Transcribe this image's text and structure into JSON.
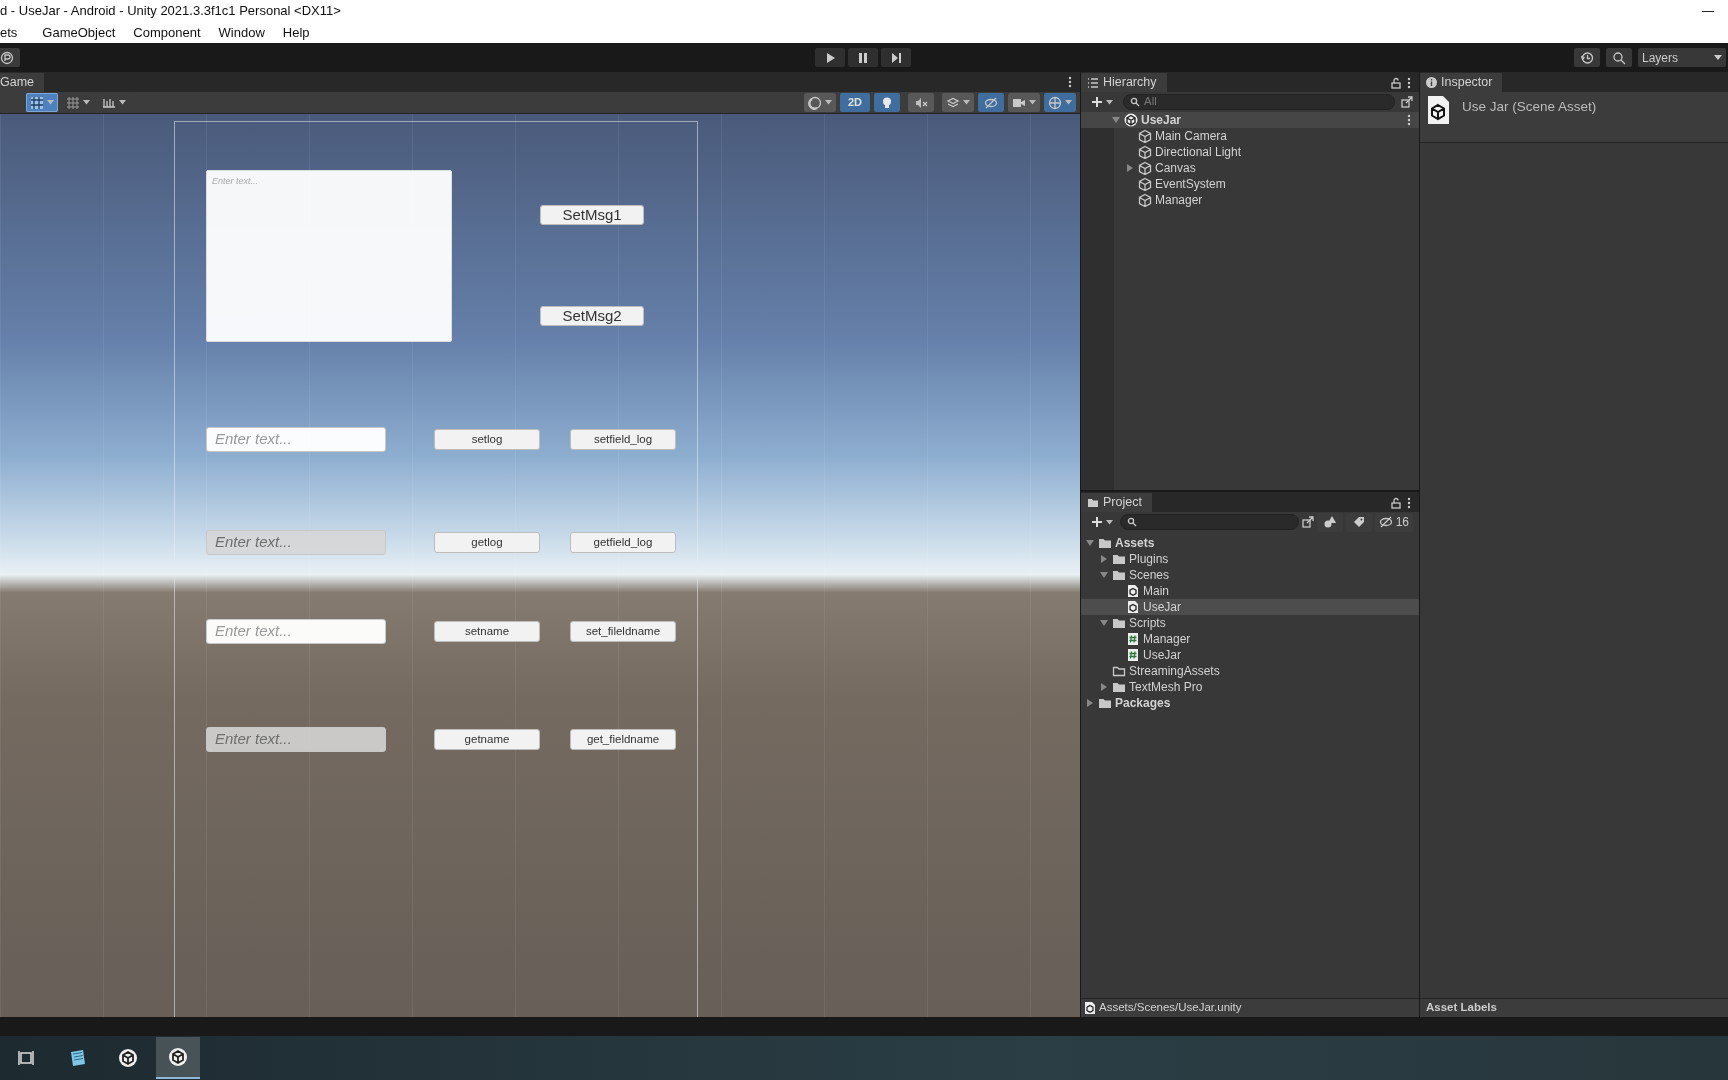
{
  "window": {
    "title": "d - UseJar - Android - Unity 2021.3.3f1c1 Personal <DX11>"
  },
  "menu": [
    "ets",
    "GameObject",
    "Component",
    "Window",
    "Help"
  ],
  "toolbar": {
    "layers": "Layers"
  },
  "game_view": {
    "tab": "Game",
    "left_tools": [
      {
        "kind": "move-grid",
        "on": true
      },
      {
        "kind": "grid",
        "on": false
      },
      {
        "kind": "ruler",
        "on": false
      }
    ],
    "scene_tools": [
      {
        "kind": "shading",
        "on": false
      },
      {
        "kind": "mode",
        "label": "2D",
        "on": true
      },
      {
        "kind": "light",
        "on": true
      },
      {
        "kind": "audio",
        "on": false
      },
      {
        "kind": "effects",
        "on": false
      },
      {
        "kind": "visibility",
        "on": true
      },
      {
        "kind": "camera",
        "on": false
      },
      {
        "kind": "gizmos",
        "on": true
      }
    ],
    "text_area": {
      "placeholder": "Enter text..."
    },
    "message_buttons": [
      "SetMsg1",
      "SetMsg2"
    ],
    "rows": [
      {
        "input": {
          "placeholder": "Enter text...",
          "disabled": false
        },
        "buttons": [
          "setlog",
          "setfield_log"
        ]
      },
      {
        "input": {
          "placeholder": "Enter text...",
          "disabled": true
        },
        "buttons": [
          "getlog",
          "getfield_log"
        ]
      },
      {
        "input": {
          "placeholder": "Enter text...",
          "disabled": false
        },
        "buttons": [
          "setname",
          "set_fileldname"
        ]
      },
      {
        "input": {
          "placeholder": "Enter text...",
          "disabled": true
        },
        "buttons": [
          "getname",
          "get_fieldname"
        ]
      }
    ]
  },
  "hierarchy": {
    "title": "Hierarchy",
    "search": {
      "placeholder": "All"
    },
    "items": [
      {
        "label": "UseJar",
        "kind": "scene",
        "expanded": true,
        "children": [
          {
            "label": "Main Camera",
            "kind": "object"
          },
          {
            "label": "Directional Light",
            "kind": "object"
          },
          {
            "label": "Canvas",
            "kind": "object",
            "expanded": false
          },
          {
            "label": "EventSystem",
            "kind": "object"
          },
          {
            "label": "Manager",
            "kind": "object"
          }
        ]
      }
    ]
  },
  "project": {
    "title": "Project",
    "hidden_count": "16",
    "items": [
      {
        "label": "Assets",
        "kind": "folder",
        "expanded": true,
        "selected": false,
        "children": [
          {
            "label": "Plugins",
            "kind": "folder",
            "expanded": false,
            "selected": false
          },
          {
            "label": "Scenes",
            "kind": "folder",
            "expanded": true,
            "selected": false,
            "children": [
              {
                "label": "Main",
                "kind": "scene-file",
                "selected": false
              },
              {
                "label": "UseJar",
                "kind": "scene-file",
                "selected": true
              }
            ]
          },
          {
            "label": "Scripts",
            "kind": "folder",
            "expanded": true,
            "selected": false,
            "children": [
              {
                "label": "Manager",
                "kind": "script",
                "selected": false
              },
              {
                "label": "UseJar",
                "kind": "script",
                "selected": false
              }
            ]
          },
          {
            "label": "StreamingAssets",
            "kind": "empty-folder",
            "selected": false
          },
          {
            "label": "TextMesh Pro",
            "kind": "folder",
            "expanded": false,
            "selected": false
          }
        ]
      },
      {
        "label": "Packages",
        "kind": "folder",
        "expanded": false,
        "selected": false
      }
    ],
    "path": "Assets/Scenes/UseJar.unity"
  },
  "inspector": {
    "title": "Inspector",
    "asset": "Use Jar (Scene Asset)",
    "footer": "Asset Labels"
  },
  "taskbar": [
    {
      "kind": "task-view",
      "selected": false
    },
    {
      "kind": "notes-app",
      "selected": false
    },
    {
      "kind": "unity",
      "selected": false
    },
    {
      "kind": "unity",
      "selected": true
    }
  ]
}
